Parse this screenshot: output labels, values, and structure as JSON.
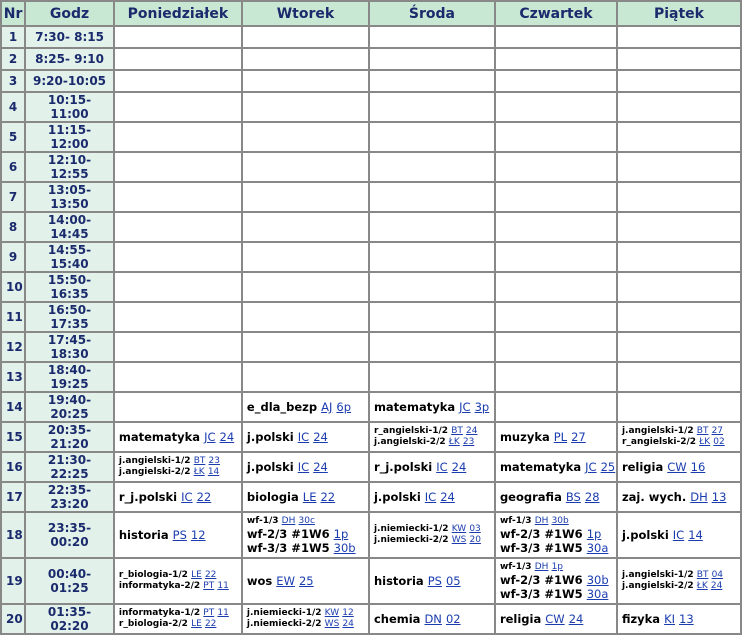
{
  "headers": [
    "Nr",
    "Godz",
    "Poniedziałek",
    "Wtorek",
    "Środa",
    "Czwartek",
    "Piątek"
  ],
  "rows": [
    {
      "nr": "1",
      "time": "7:30- 8:15",
      "days": [
        [],
        [],
        [],
        [],
        []
      ]
    },
    {
      "nr": "2",
      "time": "8:25- 9:10",
      "days": [
        [],
        [],
        [],
        [],
        []
      ]
    },
    {
      "nr": "3",
      "time": "9:20-10:05",
      "days": [
        [],
        [],
        [],
        [],
        []
      ]
    },
    {
      "nr": "4",
      "time": "10:15-11:00",
      "days": [
        [],
        [],
        [],
        [],
        []
      ]
    },
    {
      "nr": "5",
      "time": "11:15-12:00",
      "days": [
        [],
        [],
        [],
        [],
        []
      ]
    },
    {
      "nr": "6",
      "time": "12:10-12:55",
      "days": [
        [],
        [],
        [],
        [],
        []
      ]
    },
    {
      "nr": "7",
      "time": "13:05-13:50",
      "days": [
        [],
        [],
        [],
        [],
        []
      ]
    },
    {
      "nr": "8",
      "time": "14:00-14:45",
      "days": [
        [],
        [],
        [],
        [],
        []
      ]
    },
    {
      "nr": "9",
      "time": "14:55-15:40",
      "days": [
        [],
        [],
        [],
        [],
        []
      ]
    },
    {
      "nr": "10",
      "time": "15:50-16:35",
      "days": [
        [],
        [],
        [],
        [],
        []
      ]
    },
    {
      "nr": "11",
      "time": "16:50-17:35",
      "days": [
        [],
        [],
        [],
        [],
        []
      ]
    },
    {
      "nr": "12",
      "time": "17:45-18:30",
      "days": [
        [],
        [],
        [],
        [],
        []
      ]
    },
    {
      "nr": "13",
      "time": "18:40-19:25",
      "days": [
        [],
        [],
        [],
        [],
        []
      ]
    },
    {
      "nr": "14",
      "time": "19:40-20:25",
      "days": [
        [],
        [
          {
            "s": "e_dla_bezp",
            "t": "AJ",
            "r": "6p",
            "size": "big"
          }
        ],
        [
          {
            "s": "matematyka",
            "t": "JC",
            "r": "3p",
            "size": "big"
          }
        ],
        [],
        []
      ]
    },
    {
      "nr": "15",
      "time": "20:35-21:20",
      "days": [
        [
          {
            "s": "matematyka",
            "t": "JC",
            "r": "24",
            "size": "big"
          }
        ],
        [
          {
            "s": "j.polski",
            "t": "IC",
            "r": "24",
            "size": "big"
          }
        ],
        [
          {
            "s": "r_angielski-1/2",
            "t": "BT",
            "r": "24",
            "size": "small"
          },
          {
            "s": "j.angielski-2/2",
            "t": "ŁK",
            "r": "23",
            "size": "small"
          }
        ],
        [
          {
            "s": "muzyka",
            "t": "PL",
            "r": "27",
            "size": "big"
          }
        ],
        [
          {
            "s": "j.angielski-1/2",
            "t": "BT",
            "r": "27",
            "size": "small"
          },
          {
            "s": "r_angielski-2/2",
            "t": "ŁK",
            "r": "02",
            "size": "small"
          }
        ]
      ]
    },
    {
      "nr": "16",
      "time": "21:30-22:25",
      "days": [
        [
          {
            "s": "j.angielski-1/2",
            "t": "BT",
            "r": "23",
            "size": "small"
          },
          {
            "s": "j.angielski-2/2",
            "t": "ŁK",
            "r": "14",
            "size": "small"
          }
        ],
        [
          {
            "s": "j.polski",
            "t": "IC",
            "r": "24",
            "size": "big"
          }
        ],
        [
          {
            "s": "r_j.polski",
            "t": "IC",
            "r": "24",
            "size": "big"
          }
        ],
        [
          {
            "s": "matematyka",
            "t": "JC",
            "r": "25",
            "size": "big"
          }
        ],
        [
          {
            "s": "religia",
            "t": "CW",
            "r": "16",
            "size": "big"
          }
        ]
      ]
    },
    {
      "nr": "17",
      "time": "22:35-23:20",
      "days": [
        [
          {
            "s": "r_j.polski",
            "t": "IC",
            "r": "22",
            "size": "big"
          }
        ],
        [
          {
            "s": "biologia",
            "t": "LE",
            "r": "22",
            "size": "big"
          }
        ],
        [
          {
            "s": "j.polski",
            "t": "IC",
            "r": "24",
            "size": "big"
          }
        ],
        [
          {
            "s": "geografia",
            "t": "BS",
            "r": "28",
            "size": "big"
          }
        ],
        [
          {
            "s": "zaj. wych.",
            "t": "DH",
            "r": "13",
            "size": "big"
          }
        ]
      ]
    },
    {
      "nr": "18",
      "time": "23:35-00:20",
      "days": [
        [
          {
            "s": "historia",
            "t": "PS",
            "r": "12",
            "size": "big"
          }
        ],
        [
          {
            "s": "wf-1/3",
            "t": "DH",
            "r": "30c",
            "size": "small"
          },
          {
            "s": "wf-2/3 #1W6",
            "t": "",
            "r": "1p",
            "size": "big"
          },
          {
            "s": "wf-3/3 #1W5",
            "t": "",
            "r": "30b",
            "size": "big"
          }
        ],
        [
          {
            "s": "j.niemiecki-1/2",
            "t": "KW",
            "r": "03",
            "size": "small"
          },
          {
            "s": "j.niemiecki-2/2",
            "t": "WS",
            "r": "20",
            "size": "small"
          }
        ],
        [
          {
            "s": "wf-1/3",
            "t": "DH",
            "r": "30b",
            "size": "small"
          },
          {
            "s": "wf-2/3 #1W6",
            "t": "",
            "r": "1p",
            "size": "big"
          },
          {
            "s": "wf-3/3 #1W5",
            "t": "",
            "r": "30a",
            "size": "big"
          }
        ],
        [
          {
            "s": "j.polski",
            "t": "IC",
            "r": "14",
            "size": "big"
          }
        ]
      ]
    },
    {
      "nr": "19",
      "time": "00:40-01:25",
      "days": [
        [
          {
            "s": "r_biologia-1/2",
            "t": "LE",
            "r": "22",
            "size": "small"
          },
          {
            "s": "informatyka-2/2",
            "t": "PT",
            "r": "11",
            "size": "small"
          }
        ],
        [
          {
            "s": "wos",
            "t": "EW",
            "r": "25",
            "size": "big"
          }
        ],
        [
          {
            "s": "historia",
            "t": "PS",
            "r": "05",
            "size": "big"
          }
        ],
        [
          {
            "s": "wf-1/3",
            "t": "DH",
            "r": "1p",
            "size": "small"
          },
          {
            "s": "wf-2/3 #1W6",
            "t": "",
            "r": "30b",
            "size": "big"
          },
          {
            "s": "wf-3/3 #1W5",
            "t": "",
            "r": "30a",
            "size": "big"
          }
        ],
        [
          {
            "s": "j.angielski-1/2",
            "t": "BT",
            "r": "04",
            "size": "small"
          },
          {
            "s": "j.angielski-2/2",
            "t": "ŁK",
            "r": "24",
            "size": "small"
          }
        ]
      ]
    },
    {
      "nr": "20",
      "time": "01:35-02:20",
      "days": [
        [
          {
            "s": "informatyka-1/2",
            "t": "PT",
            "r": "11",
            "size": "small"
          },
          {
            "s": "r_biologia-2/2",
            "t": "LE",
            "r": "22",
            "size": "small"
          }
        ],
        [
          {
            "s": "j.niemiecki-1/2",
            "t": "KW",
            "r": "12",
            "size": "small"
          },
          {
            "s": "j.niemiecki-2/2",
            "t": "WS",
            "r": "24",
            "size": "small"
          }
        ],
        [
          {
            "s": "chemia",
            "t": "DN",
            "r": "02",
            "size": "big"
          }
        ],
        [
          {
            "s": "religia",
            "t": "CW",
            "r": "24",
            "size": "big"
          }
        ],
        [
          {
            "s": "fizyka",
            "t": "KI",
            "r": "13",
            "size": "big"
          }
        ]
      ]
    }
  ]
}
